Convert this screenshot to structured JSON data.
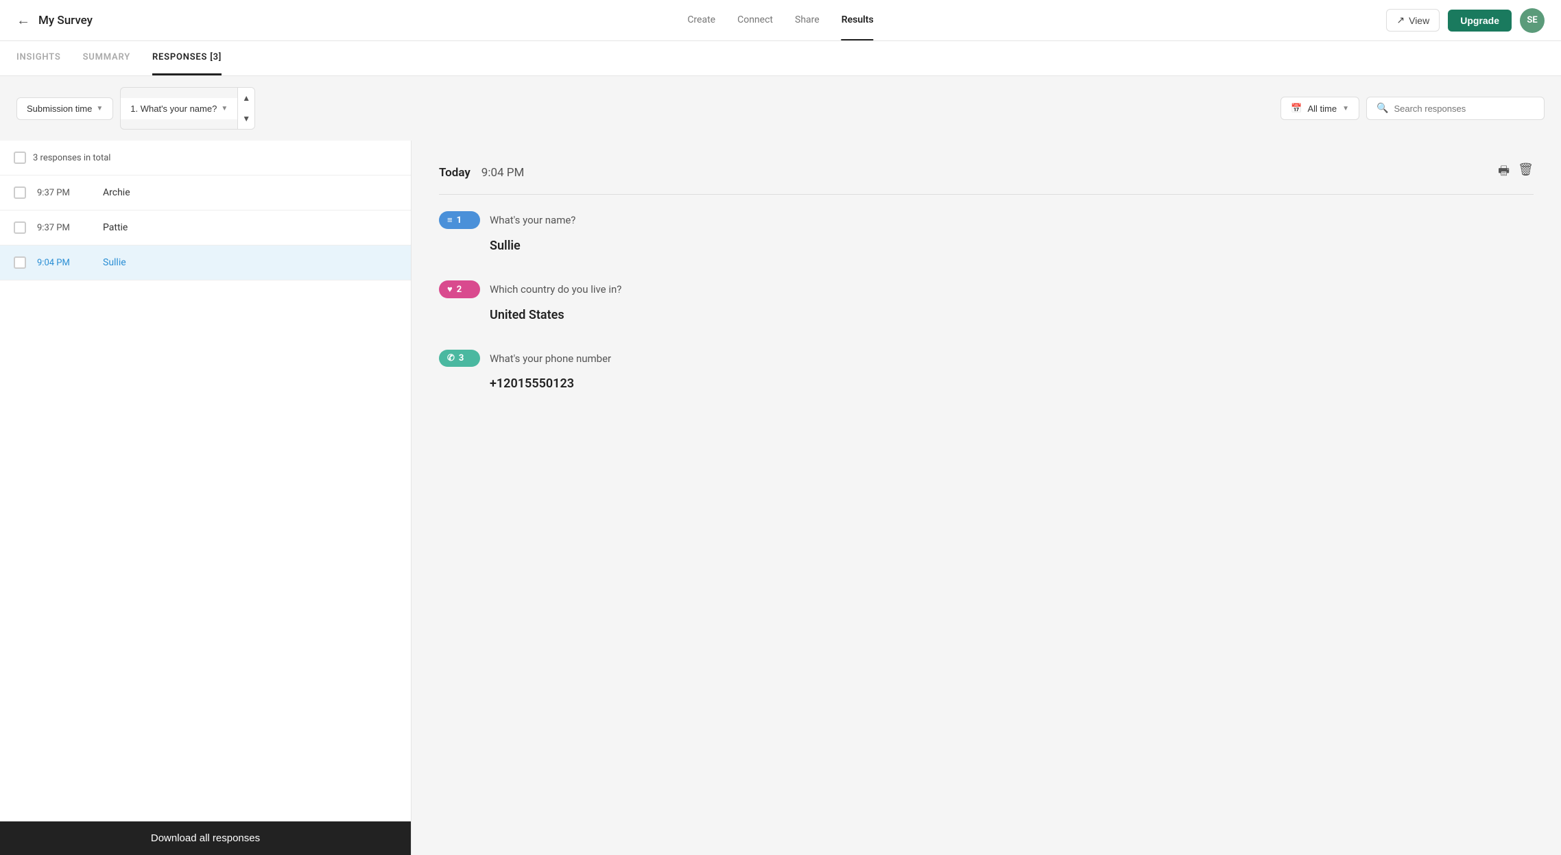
{
  "app": {
    "title": "My Survey",
    "nav_links": [
      "Create",
      "Connect",
      "Share",
      "Results"
    ],
    "active_nav": "Results",
    "view_btn": "View",
    "upgrade_btn": "Upgrade",
    "avatar_initials": "SE"
  },
  "tabs": [
    "INSIGHTS",
    "SUMMARY",
    "RESPONSES [3]"
  ],
  "active_tab": "RESPONSES [3]",
  "filters": {
    "submission_time": "Submission time",
    "question": "1. What's your name?",
    "date_filter": "All time",
    "search_placeholder": "Search responses"
  },
  "responses": {
    "total_label": "3 responses in total",
    "items": [
      {
        "time": "9:37 PM",
        "name": "Archie",
        "active": false
      },
      {
        "time": "9:37 PM",
        "name": "Pattie",
        "active": false
      },
      {
        "time": "9:04 PM",
        "name": "Sullie",
        "active": true
      }
    ],
    "download_label": "Download all responses"
  },
  "selected_response": {
    "date": "Today",
    "time": "9:04 PM",
    "questions": [
      {
        "number": "1",
        "badge_type": "blue",
        "icon": "≡",
        "question": "What's your name?",
        "answer": "Sullie"
      },
      {
        "number": "2",
        "badge_type": "pink",
        "icon": "♥",
        "question": "Which country do you live in?",
        "answer": "United States"
      },
      {
        "number": "3",
        "badge_type": "teal",
        "icon": "✆",
        "question": "What's your phone number",
        "answer": "+12015550123"
      }
    ]
  }
}
